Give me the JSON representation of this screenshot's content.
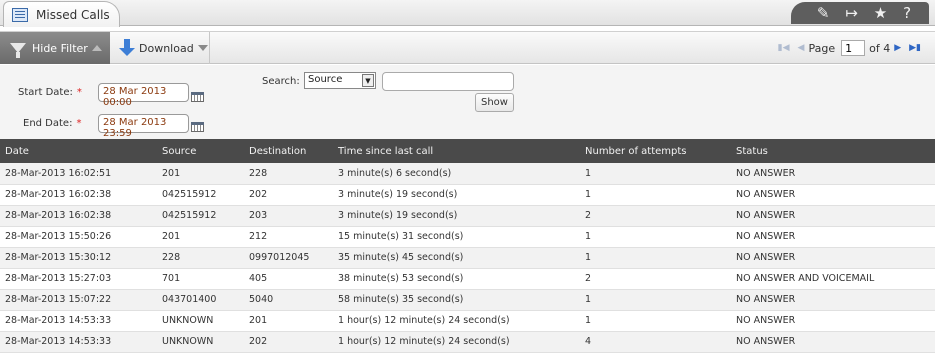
{
  "window": {
    "tab_title": "Missed Calls",
    "tools": [
      "edit-icon",
      "export-icon",
      "favorite-icon",
      "help-icon"
    ]
  },
  "toolbar": {
    "hide_filter_label": "Hide Filter",
    "download_label": "Download",
    "pager": {
      "page_label": "Page",
      "current_page": "1",
      "of_label": "of 4"
    }
  },
  "filter": {
    "start_label": "Start Date:",
    "start_value": "28 Mar 2013 00:00",
    "end_label": "End Date:",
    "end_value": "28 Mar 2013 23:59",
    "search_label": "Search:",
    "search_field": "Source",
    "search_value": "",
    "show_label": "Show",
    "required_mark": "*"
  },
  "table": {
    "headers": [
      "Date",
      "Source",
      "Destination",
      "Time since last call",
      "Number of attempts",
      "Status"
    ],
    "rows": [
      [
        "28-Mar-2013 16:02:51",
        "201",
        "228",
        "3 minute(s) 6 second(s)",
        "1",
        "NO ANSWER"
      ],
      [
        "28-Mar-2013 16:02:38",
        "042515912",
        "202",
        "3 minute(s) 19 second(s)",
        "1",
        "NO ANSWER"
      ],
      [
        "28-Mar-2013 16:02:38",
        "042515912",
        "203",
        "3 minute(s) 19 second(s)",
        "2",
        "NO ANSWER"
      ],
      [
        "28-Mar-2013 15:50:26",
        "201",
        "212",
        "15 minute(s) 31 second(s)",
        "1",
        "NO ANSWER"
      ],
      [
        "28-Mar-2013 15:30:12",
        "228",
        "0997012045",
        "35 minute(s) 45 second(s)",
        "1",
        "NO ANSWER"
      ],
      [
        "28-Mar-2013 15:27:03",
        "701",
        "405",
        "38 minute(s) 53 second(s)",
        "2",
        "NO ANSWER AND VOICEMAIL"
      ],
      [
        "28-Mar-2013 15:07:22",
        "043701400",
        "5040",
        "58 minute(s) 35 second(s)",
        "1",
        "NO ANSWER"
      ],
      [
        "28-Mar-2013 14:53:33",
        "UNKNOWN",
        "201",
        "1 hour(s) 12 minute(s) 24 second(s)",
        "1",
        "NO ANSWER"
      ],
      [
        "28-Mar-2013 14:53:33",
        "UNKNOWN",
        "202",
        "1 hour(s) 12 minute(s) 24 second(s)",
        "4",
        "NO ANSWER"
      ]
    ]
  }
}
